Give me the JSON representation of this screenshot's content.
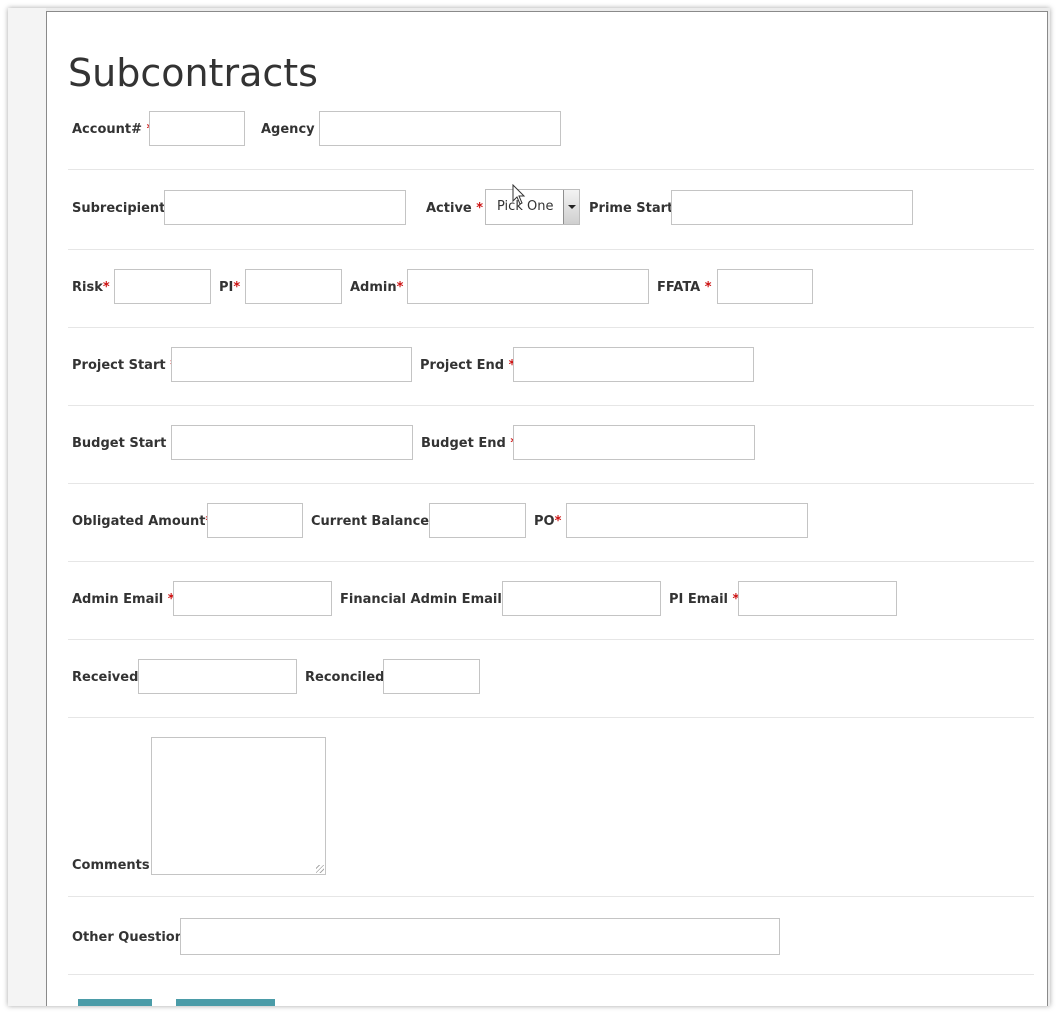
{
  "form": {
    "title": "Subcontracts",
    "required_marker": "*",
    "fields": {
      "account": "Account#",
      "agency": "Agency",
      "subrecipient": "Subrecipient",
      "active": "Active",
      "prime_start": "Prime Start",
      "risk": "Risk",
      "pi": "PI",
      "admin": "Admin",
      "ffata": "FFATA",
      "project_start": "Project Start",
      "project_end": "Project End",
      "budget_start": "Budget Start",
      "budget_end": "Budget End",
      "obligated_amount": "Obligated Amount",
      "current_balance": "Current Balance",
      "po": "PO",
      "admin_email": "Admin Email",
      "financial_admin_email": "Financial Admin Email",
      "pi_email": "PI Email",
      "received": "Received",
      "reconciled": "Reconciled",
      "comments": "Comments",
      "other_question": "Other Question"
    },
    "active_select_value": "Pick One"
  },
  "colors": {
    "required": "#cc1111",
    "button": "#4b9ca8",
    "row_divider": "#e6e6e6"
  }
}
